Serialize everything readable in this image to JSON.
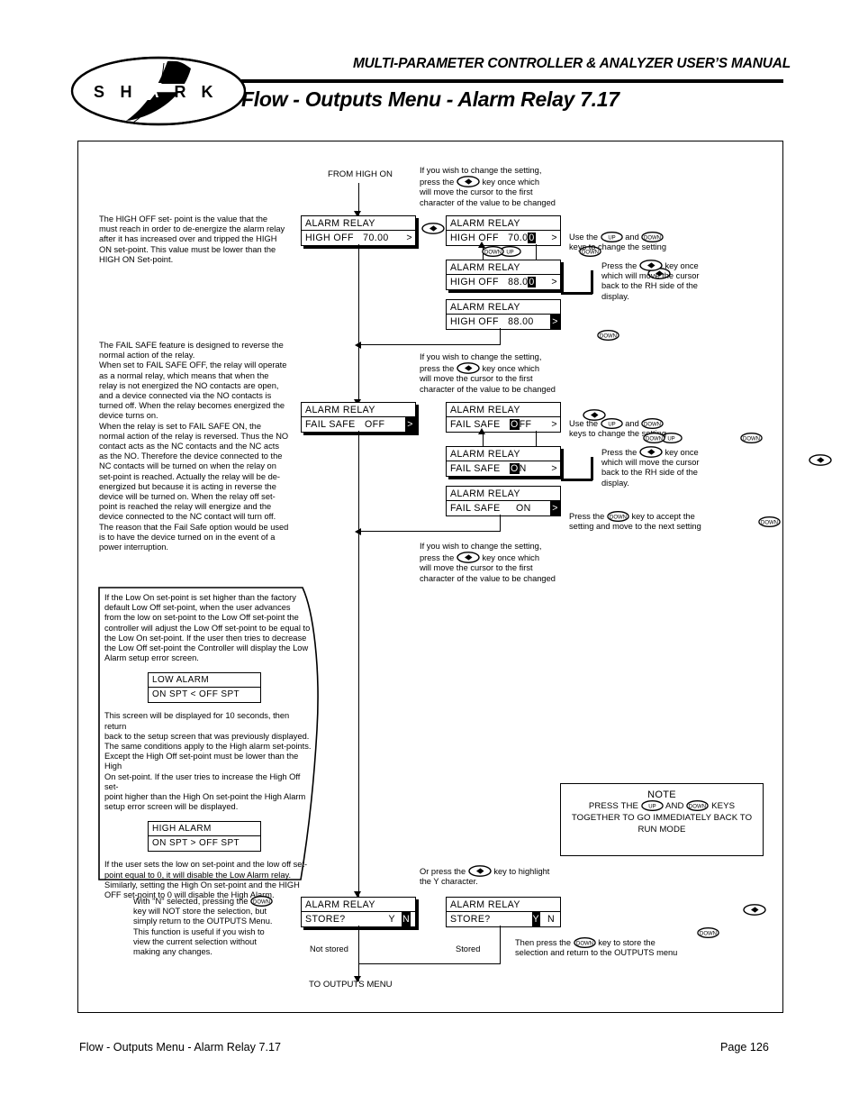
{
  "header": {
    "manual_title": "MULTI-PARAMETER CONTROLLER & ANALYZER USER’S MANUAL",
    "page_heading": "Flow - Outputs Menu - Alarm Relay 7.17",
    "logo_letters": [
      "S",
      "H",
      "A",
      "R",
      "K"
    ]
  },
  "footer": {
    "left": "Flow - Outputs Menu - Alarm Relay 7.17",
    "right": "Page 126"
  },
  "flow": {
    "entry_label": "FROM HIGH ON",
    "exit_label": "TO OUTPUTS MENU"
  },
  "keys": {
    "left_right": "◀▶",
    "up": "UP",
    "down": "DOWN"
  },
  "instructions": {
    "change_setting_1": "If you wish to change the setting,",
    "change_setting_2a": "press the",
    "change_setting_2b": "key once which",
    "change_setting_3": "will move the cursor to the first",
    "change_setting_4": "character of the value to be changed",
    "use_updown_a": "Use the",
    "use_updown_b": "and",
    "use_updown_c": "keys to change the setting",
    "press_lr_1a": "Press the",
    "press_lr_1b": "key once",
    "press_lr_2": "which will move the cursor",
    "press_lr_3": "back to the RH side of the",
    "press_lr_4": "display.",
    "accept_1a": "Press the",
    "accept_1b": "key to accept the",
    "accept_2": "setting and move to the next setting",
    "highlight_y_1a": "Or press the",
    "highlight_y_1b": "key to highlight",
    "highlight_y_2": "the Y character.",
    "store_then_1a": "Then press the",
    "store_then_1b": "key to store the",
    "store_then_2": "selection and return to the OUTPUTS menu"
  },
  "high_off_text": [
    "The HIGH OFF set- point is the value that the",
    "must reach in order to de-energize the alarm relay",
    "after it has increased over and tripped the HIGH",
    "ON set-point. This value must be lower than the",
    "HIGH ON Set-point."
  ],
  "fail_safe_text": [
    "The FAIL SAFE feature is designed to reverse the",
    "normal action of the relay.",
    "When set to FAIL SAFE OFF, the relay will operate",
    "as a normal relay, which means that when the",
    "relay is not energized the NO contacts are open,",
    "and a device connected via the NO contacts is",
    "turned off. When the relay becomes energized the",
    "device turns on.",
    "When the relay is set to FAIL SAFE ON, the",
    "normal action of the relay is reversed. Thus the NO",
    "contact acts as the NC contacts and the NC acts",
    "as the NO. Therefore the device connected to the",
    "NC contacts will be turned on when the relay on",
    "set-point is reached. Actually the relay will be de-",
    "energized but because it is acting in reverse the",
    "device will be turned on. When the relay off set-",
    "point is reached the relay will energize and the",
    "device connected to the NC contact will turn off.",
    "The reason that the Fail Safe option would be used",
    "is to have the device turned on in the event of a",
    "power interruption."
  ],
  "callout": {
    "para1": [
      "If the Low On set-point is set higher than the factory",
      "default Low Off set-point, when the user advances",
      "from the low on set-point to the Low Off set-point the",
      "controller will adjust the Low Off set-point to be equal to",
      "the Low On set-point. If the user then tries to decrease",
      "the Low Off set-point the Controller will display the Low",
      "Alarm setup error screen."
    ],
    "para2": [
      "This screen will be displayed for 10 seconds, then return",
      "back to the setup screen that was previously displayed.",
      "The same conditions apply to the High alarm set-points.",
      "Except the High Off set-point must be lower than the High",
      "On set-point. If the user tries to increase the High Off set-",
      "point higher than the High On set-point the High Alarm",
      "setup error screen will be displayed."
    ],
    "para3": [
      "If the user sets the low on set-point and the low off set-",
      "point equal to 0, it will disable the Low Alarm relay.",
      "Similarly, setting the High On set-point and the HIGH",
      "OFF set-point to 0 will disable the High Alarm."
    ],
    "low_alarm_screen": {
      "line1": "LOW ALARM",
      "line2": "ON  SPT  <  OFF  SPT"
    },
    "high_alarm_screen": {
      "line1": "HIGH ALARM",
      "line2": "ON  SPT  >  OFF  SPT"
    }
  },
  "store_note": [
    "With \"N\" selected, pressing the",
    "key will NOT store the selection, but",
    "simply return to the OUTPUTS Menu.",
    "This function is useful if you wish to",
    "view the current selection without",
    "making any changes."
  ],
  "note_box": {
    "title": "NOTE",
    "line1a": "PRESS THE",
    "line1b": "AND",
    "line1c": "KEYS",
    "line2": "TOGETHER TO GO IMMEDIATELY BACK TO",
    "line3": "RUN MODE"
  },
  "screens": {
    "high_off_70": {
      "line1": "ALARM RELAY",
      "label": "HIGH   OFF",
      "value": "70.00",
      "marker": ">"
    },
    "high_off_70_cursor": {
      "line1": "ALARM RELAY",
      "label": "HIGH   OFF",
      "value_pre": "70.0",
      "value_cursor": "0",
      "marker": ">"
    },
    "high_off_88_cursor": {
      "line1": "ALARM RELAY",
      "label": "HIGH   OFF",
      "value_pre": "88.0",
      "value_cursor": "0",
      "marker": ">"
    },
    "high_off_88": {
      "line1": "ALARM RELAY",
      "label": "HIGH   OFF",
      "value": "88.00",
      "marker": ">"
    },
    "fail_safe_off": {
      "line1": "ALARM RELAY",
      "label": "FAIL  SAFE",
      "value": "OFF",
      "marker": ">"
    },
    "fail_safe_off_cursor": {
      "line1": "ALARM RELAY",
      "label": "FAIL  SAFE",
      "value_cursor": "O",
      "value_post": "FF",
      "marker": ">"
    },
    "fail_safe_on_cursor": {
      "line1": "ALARM RELAY",
      "label": "FAIL  SAFE",
      "value_cursor": "O",
      "value_post": "N",
      "marker": ">"
    },
    "fail_safe_on": {
      "line1": "ALARM RELAY",
      "label": "FAIL  SAFE",
      "value": "ON",
      "marker": ">"
    },
    "store_n": {
      "line1": "ALARM RELAY",
      "label": "STORE?",
      "y": "Y",
      "n": "N"
    },
    "store_y": {
      "line1": "ALARM RELAY",
      "label": "STORE?",
      "y": "Y",
      "n": "N"
    }
  },
  "store_labels": {
    "not_stored": "Not stored",
    "stored": "Stored"
  }
}
